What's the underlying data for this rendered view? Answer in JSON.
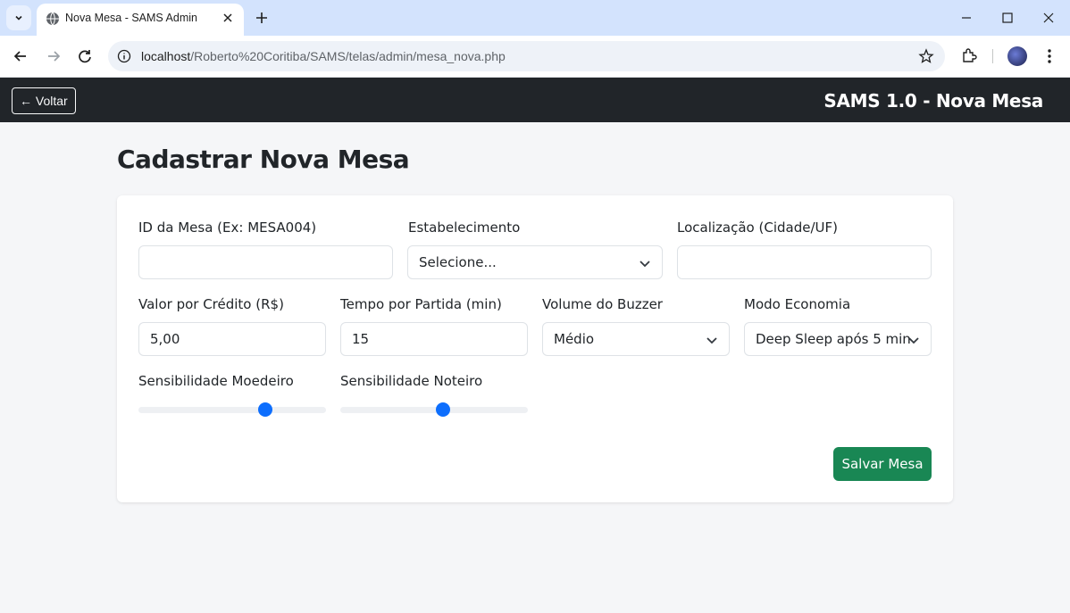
{
  "browser": {
    "tab_title": "Nova Mesa - SAMS Admin",
    "url_host": "localhost",
    "url_path": "/Roberto%20Coritiba/SAMS/telas/admin/mesa_nova.php"
  },
  "appbar": {
    "back_label": "← Voltar",
    "brand": "SAMS 1.0 - Nova Mesa"
  },
  "page": {
    "title": "Cadastrar Nova Mesa"
  },
  "form": {
    "id_mesa": {
      "label": "ID da Mesa (Ex: MESA004)",
      "value": ""
    },
    "estabelecimento": {
      "label": "Estabelecimento",
      "selected": "Selecione..."
    },
    "localizacao": {
      "label": "Localização (Cidade/UF)",
      "value": ""
    },
    "valor_credito": {
      "label": "Valor por Crédito (R$)",
      "value": "5,00"
    },
    "tempo_partida": {
      "label": "Tempo por Partida (min)",
      "value": "15"
    },
    "volume_buzzer": {
      "label": "Volume do Buzzer",
      "selected": "Médio"
    },
    "modo_economia": {
      "label": "Modo Economia",
      "selected": "Deep Sleep após 5 min"
    },
    "sens_moedeiro": {
      "label": "Sensibilidade Moedeiro",
      "level": 0.69
    },
    "sens_noteiro": {
      "label": "Sensibilidade Noteiro",
      "level": 0.55
    },
    "save_label": "Salvar Mesa"
  },
  "colors": {
    "navbar": "#212529",
    "primary": "#0d6efd",
    "success": "#198754",
    "page_bg": "#f5f6f8"
  }
}
